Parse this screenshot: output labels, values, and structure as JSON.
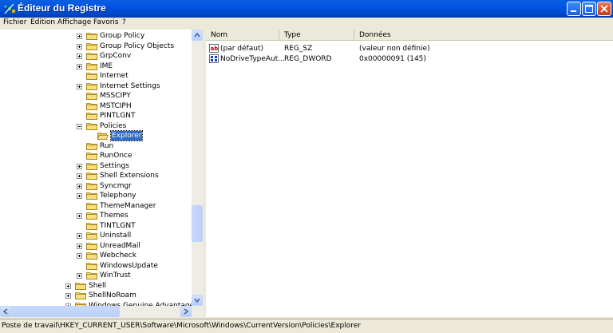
{
  "window": {
    "title": "Éditeur du Registre"
  },
  "menu": [
    "Fichier",
    "Edition",
    "Affichage",
    "Favoris",
    "?"
  ],
  "tree": {
    "items": [
      {
        "label": "Group Policy",
        "depth": 3,
        "expander": "plus"
      },
      {
        "label": "Group Policy Objects",
        "depth": 3,
        "expander": "plus"
      },
      {
        "label": "GrpConv",
        "depth": 3,
        "expander": "plus"
      },
      {
        "label": "IME",
        "depth": 3,
        "expander": "plus"
      },
      {
        "label": "Internet",
        "depth": 3,
        "expander": "none"
      },
      {
        "label": "Internet Settings",
        "depth": 3,
        "expander": "plus"
      },
      {
        "label": "MSSCIPY",
        "depth": 3,
        "expander": "none"
      },
      {
        "label": "MSTCIPH",
        "depth": 3,
        "expander": "none"
      },
      {
        "label": "PINTLGNT",
        "depth": 3,
        "expander": "none"
      },
      {
        "label": "Policies",
        "depth": 3,
        "expander": "minus"
      },
      {
        "label": "Explorer",
        "depth": 4,
        "expander": "none",
        "selected": true,
        "open": true
      },
      {
        "label": "Run",
        "depth": 3,
        "expander": "none"
      },
      {
        "label": "RunOnce",
        "depth": 3,
        "expander": "none"
      },
      {
        "label": "Settings",
        "depth": 3,
        "expander": "plus"
      },
      {
        "label": "Shell Extensions",
        "depth": 3,
        "expander": "plus"
      },
      {
        "label": "Syncmgr",
        "depth": 3,
        "expander": "plus"
      },
      {
        "label": "Telephony",
        "depth": 3,
        "expander": "plus"
      },
      {
        "label": "ThemeManager",
        "depth": 3,
        "expander": "none"
      },
      {
        "label": "Themes",
        "depth": 3,
        "expander": "plus"
      },
      {
        "label": "TINTLGNT",
        "depth": 3,
        "expander": "none"
      },
      {
        "label": "Uninstall",
        "depth": 3,
        "expander": "plus"
      },
      {
        "label": "UnreadMail",
        "depth": 3,
        "expander": "plus"
      },
      {
        "label": "Webcheck",
        "depth": 3,
        "expander": "plus"
      },
      {
        "label": "WindowsUpdate",
        "depth": 3,
        "expander": "none"
      },
      {
        "label": "WinTrust",
        "depth": 3,
        "expander": "plus"
      },
      {
        "label": "Shell",
        "depth": 2,
        "expander": "plus"
      },
      {
        "label": "ShellNoRoam",
        "depth": 2,
        "expander": "plus"
      },
      {
        "label": "Windows Genuine Advantage",
        "depth": 2,
        "expander": "plus"
      }
    ]
  },
  "list": {
    "columns": [
      "Nom",
      "Type",
      "Données"
    ],
    "rows": [
      {
        "icon": "string-value-icon",
        "name": "(par défaut)",
        "type": "REG_SZ",
        "data": "(valeur non définie)"
      },
      {
        "icon": "binary-value-icon",
        "name": "NoDriveTypeAut...",
        "type": "REG_DWORD",
        "data": "0x00000091 (145)"
      }
    ]
  },
  "status": {
    "path": "Poste de travail\\HKEY_CURRENT_USER\\Software\\Microsoft\\Windows\\CurrentVersion\\Policies\\Explorer"
  },
  "colors": {
    "titlebar": "#0054e3",
    "selection": "#316ac5",
    "chrome": "#ece9d8",
    "folder": "#f5d86b"
  },
  "icons": {
    "app": "regedit-icon",
    "folder": "folder-icon",
    "minimize": "minimize-icon",
    "maximize": "maximize-icon",
    "close": "close-icon"
  }
}
